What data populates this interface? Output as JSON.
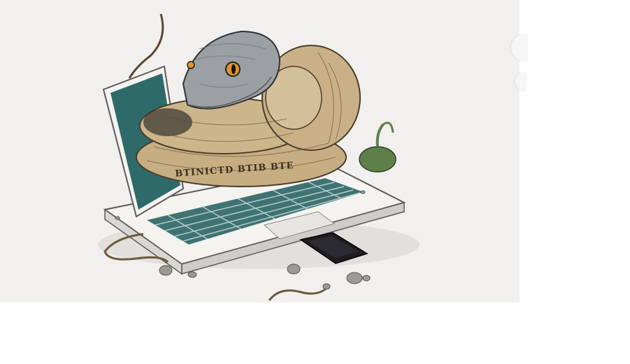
{
  "image": {
    "description_alt": "",
    "coil_text": "BTINICTD BTIB BTE",
    "colors": {
      "background": "#f1f0ee",
      "screen": "#2f6a6a",
      "laptop_body": "#f4f3ef",
      "snake_body": "#c7ae82",
      "snake_head": "#9aa0a3",
      "eye": "#e0952a",
      "keys": "#3f7373",
      "phone": "#1e1e22",
      "plant": "#5f7f4a"
    }
  }
}
